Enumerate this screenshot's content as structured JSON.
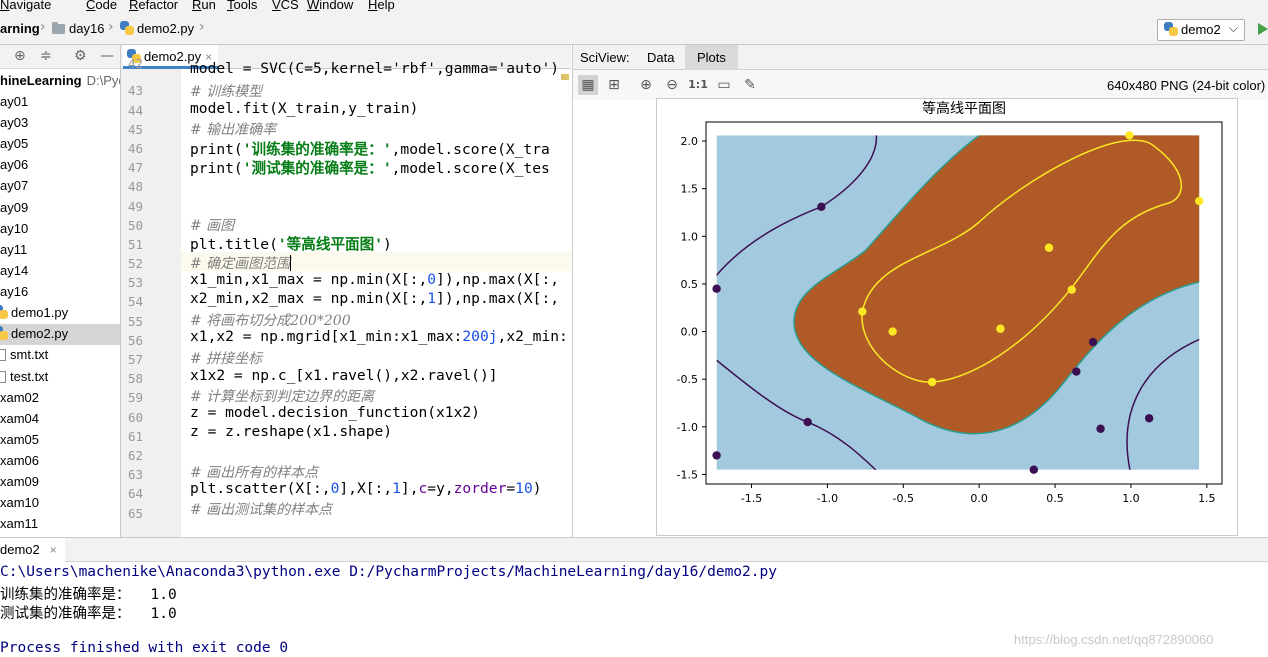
{
  "menu": [
    "Navigate",
    "Code",
    "Refactor",
    "Run",
    "Tools",
    "VCS",
    "Window",
    "Help"
  ],
  "breadcrumb": {
    "project": "arning",
    "folder": "day16",
    "file": "demo2.py"
  },
  "run_config": {
    "label": "demo2"
  },
  "project_tree": {
    "root_name": "hineLearning",
    "root_path": "D:\\Pych",
    "items": [
      "ay01",
      "ay03",
      "ay05",
      "ay06",
      "ay07",
      "ay09",
      "ay10",
      "ay11",
      "ay14",
      "ay16",
      "demo1.py",
      "demo2.py",
      "smt.txt",
      "test.txt",
      "xam02",
      "xam04",
      "xam05",
      "xam06",
      "xam09",
      "xam10",
      "xam11"
    ]
  },
  "editor": {
    "tab_label": "demo2.py",
    "line_numbers": [
      "42",
      "43",
      "44",
      "45",
      "46",
      "47",
      "48",
      "49",
      "50",
      "51",
      "52",
      "53",
      "54",
      "55",
      "56",
      "57",
      "58",
      "59",
      "60",
      "61",
      "62",
      "63",
      "64",
      "65"
    ],
    "lines": {
      "l42": "model = SVC(C=5,kernel='rbf',gamma='auto')",
      "l43": "# 训练模型",
      "l44": "model.fit(X_train,y_train)",
      "l45": "# 输出准确率",
      "l46_a": "print(",
      "l46_b": "'训练集的准确率是：'",
      "l46_c": ",model.score(X_tra",
      "l47_a": "print(",
      "l47_b": "'测试集的准确率是：'",
      "l47_c": ",model.score(X_tes",
      "l50": "# 画图",
      "l51_a": "plt.title(",
      "l51_b": "'等高线平面图'",
      "l51_c": ")",
      "l52": "# 确定画图范围",
      "l53_a": "x1_min,x1_max = np.min(X[:,",
      "l53_b": "0",
      "l53_c": "]),np.max(X[:,",
      "l54_a": "x2_min,x2_max = np.min(X[:,",
      "l54_b": "1",
      "l54_c": "]),np.max(X[:,",
      "l55": "# 将画布切分成200*200",
      "l56_a": "x1,x2 = np.mgrid[x1_min:x1_max:",
      "l56_b": "200j",
      "l56_c": ",x2_min:",
      "l57": "# 拼接坐标",
      "l58": "x1x2 = np.c_[x1.ravel(),x2.ravel()]",
      "l59": "# 计算坐标到判定边界的距离",
      "l60": "z = model.decision_function(x1x2)",
      "l61": "z = z.reshape(x1.shape)",
      "l63": "# 画出所有的样本点",
      "l64_a": "plt.scatter(X[:,",
      "l64_b": "0",
      "l64_c": "],X[:,",
      "l64_d": "1",
      "l64_e": "],",
      "l64_f": "c",
      "l64_g": "=y,",
      "l64_h": "zorder",
      "l64_i": "=",
      "l64_j": "10",
      "l64_k": ")",
      "l65": "# 画出测试集的样本点"
    }
  },
  "sciview": {
    "title": "SciView:",
    "tabs": [
      "Data",
      "Plots"
    ],
    "active_tab": "Plots",
    "zoom_label": "1:1",
    "image_info": "640x480 PNG (24-bit color)"
  },
  "chart_data": {
    "type": "scatter",
    "title": "等高线平面图",
    "xlim": [
      -1.8,
      1.6
    ],
    "ylim": [
      -1.6,
      2.2
    ],
    "xticks": [
      "-1.5",
      "-1.0",
      "-0.5",
      "0.0",
      "0.5",
      "1.0",
      "1.5"
    ],
    "yticks": [
      "2.0",
      "1.5",
      "1.0",
      "0.5",
      "0.0",
      "-0.5",
      "-1.0",
      "-1.5"
    ],
    "colors": {
      "region_neg": "#a3c9df",
      "region_pos": "#b05a27",
      "class0": "#3b0f52",
      "class1": "#fde725",
      "boundary": "#2a9d8f"
    },
    "series": [
      {
        "points": [
          [
            -1.73,
            0.45
          ],
          [
            -1.73,
            -1.3
          ],
          [
            -1.04,
            1.31
          ],
          [
            -1.13,
            -0.95
          ],
          [
            0.36,
            -1.45
          ],
          [
            0.75,
            -0.11
          ],
          [
            0.64,
            -0.42
          ],
          [
            0.8,
            -1.02
          ],
          [
            1.12,
            -0.91
          ]
        ]
      },
      {
        "points": [
          [
            -0.77,
            0.21
          ],
          [
            -0.57,
            0.0
          ],
          [
            -0.31,
            -0.53
          ],
          [
            0.14,
            0.03
          ],
          [
            0.46,
            0.88
          ],
          [
            0.61,
            0.44
          ],
          [
            0.99,
            2.06
          ],
          [
            1.45,
            1.37
          ]
        ]
      }
    ]
  },
  "run_panel": {
    "tab_label": "demo2",
    "command": "C:\\Users\\machenike\\Anaconda3\\python.exe D:/PycharmProjects/MachineLearning/day16/demo2.py",
    "train_label": "训练集的准确率是：",
    "train_value": "1.0",
    "test_label": "测试集的准确率是：",
    "test_value": "1.0",
    "exit_line": "Process finished with exit code 0",
    "watermark": "https://blog.csdn.net/qq872890060"
  }
}
